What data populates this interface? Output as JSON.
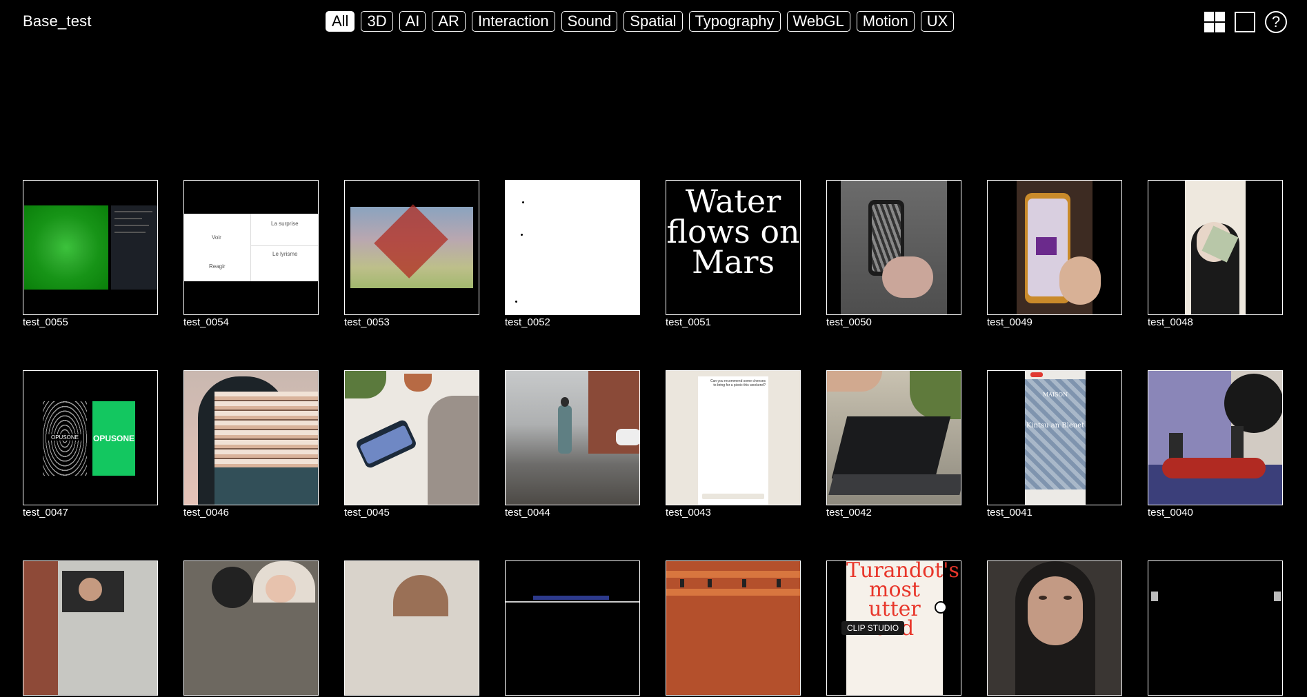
{
  "header": {
    "brand": "Base_test",
    "filters": [
      {
        "label": "All",
        "active": true
      },
      {
        "label": "3D"
      },
      {
        "label": "AI"
      },
      {
        "label": "AR"
      },
      {
        "label": "Interaction"
      },
      {
        "label": "Sound"
      },
      {
        "label": "Spatial"
      },
      {
        "label": "Typography"
      },
      {
        "label": "WebGL"
      },
      {
        "label": "Motion"
      },
      {
        "label": "UX"
      }
    ],
    "view_icons": [
      "grid-view-icon",
      "single-view-icon",
      "help-icon"
    ],
    "help_glyph": "?"
  },
  "items": [
    {
      "title": "test_0055"
    },
    {
      "title": "test_0054",
      "thumb_text": [
        "Voir",
        "La surprise",
        "Reagir",
        "Le lyrisme"
      ]
    },
    {
      "title": "test_0053"
    },
    {
      "title": "test_0052"
    },
    {
      "title": "test_0051",
      "thumb_text": "Water flows on Mars"
    },
    {
      "title": "test_0050"
    },
    {
      "title": "test_0049"
    },
    {
      "title": "test_0048"
    },
    {
      "title": "test_0047",
      "thumb_text": [
        "OPUSONE",
        "OPUSONE"
      ]
    },
    {
      "title": "test_0046"
    },
    {
      "title": "test_0045"
    },
    {
      "title": "test_0044"
    },
    {
      "title": "test_0043",
      "thumb_text": "Can you recommend some cheeses to bring for a picnic this weekend?"
    },
    {
      "title": "test_0042"
    },
    {
      "title": "test_0041",
      "thumb_text": [
        "MAISON",
        "Kintsu an Bleuet"
      ]
    },
    {
      "title": "test_0040"
    },
    {
      "title": ""
    },
    {
      "title": ""
    },
    {
      "title": ""
    },
    {
      "title": ""
    },
    {
      "title": ""
    },
    {
      "title": "",
      "thumb_text": "Turandot's most utter and"
    },
    {
      "title": ""
    },
    {
      "title": ""
    }
  ],
  "tooltip": "CLIP STUDIO",
  "colors": {
    "background": "#000000",
    "foreground": "#ffffff",
    "active_chip_text": "#000000",
    "opusone_green": "#13c760",
    "turandot_red": "#e8362a"
  }
}
